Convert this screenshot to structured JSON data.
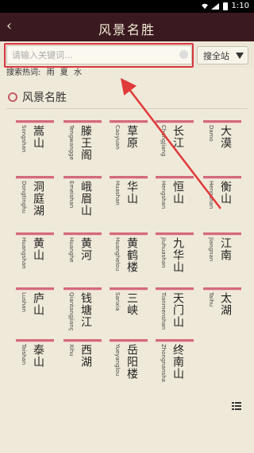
{
  "status": {
    "time": "1:10"
  },
  "header": {
    "back_icon": "‹",
    "title": "风景名胜"
  },
  "search": {
    "placeholder": "请输入关键词...",
    "scope": "搜全站"
  },
  "hot": {
    "label": "搜索热词:",
    "keywords": [
      "雨",
      "夏",
      "水"
    ]
  },
  "section": {
    "title": "风景名胜"
  },
  "accent": "#d46a7a",
  "places": [
    {
      "name": "嵩山",
      "pinyin": "Songshan"
    },
    {
      "name": "滕王阁",
      "pinyin": "Tengwangge"
    },
    {
      "name": "草原",
      "pinyin": "Caoyuan"
    },
    {
      "name": "长江",
      "pinyin": "Changjiang"
    },
    {
      "name": "大漠",
      "pinyin": "Damo"
    },
    {
      "name": "洞庭湖",
      "pinyin": "Dongtinghu"
    },
    {
      "name": "峨眉山",
      "pinyin": "Emeishan"
    },
    {
      "name": "华山",
      "pinyin": "Huashan"
    },
    {
      "name": "恒山",
      "pinyin": "Hengshan"
    },
    {
      "name": "衡山",
      "pinyin": "Hengshan"
    },
    {
      "name": "黄山",
      "pinyin": "Huangshan"
    },
    {
      "name": "黄河",
      "pinyin": "Huanghe"
    },
    {
      "name": "黄鹤楼",
      "pinyin": "Huanghelou"
    },
    {
      "name": "九华山",
      "pinyin": "Jiuhuashan"
    },
    {
      "name": "江南",
      "pinyin": "Jiangnan"
    },
    {
      "name": "庐山",
      "pinyin": "Lushan"
    },
    {
      "name": "钱塘江",
      "pinyin": "Qiantangjiang"
    },
    {
      "name": "三峡",
      "pinyin": "Sanxia"
    },
    {
      "name": "天门山",
      "pinyin": "Tianmenshan"
    },
    {
      "name": "太湖",
      "pinyin": "Taihu"
    },
    {
      "name": "泰山",
      "pinyin": "Taishan"
    },
    {
      "name": "西湖",
      "pinyin": "Xihu"
    },
    {
      "name": "岳阳楼",
      "pinyin": "Yueyanglou"
    },
    {
      "name": "终南山",
      "pinyin": "Zhongnanshan"
    }
  ],
  "icons": {
    "list": "list-icon"
  }
}
